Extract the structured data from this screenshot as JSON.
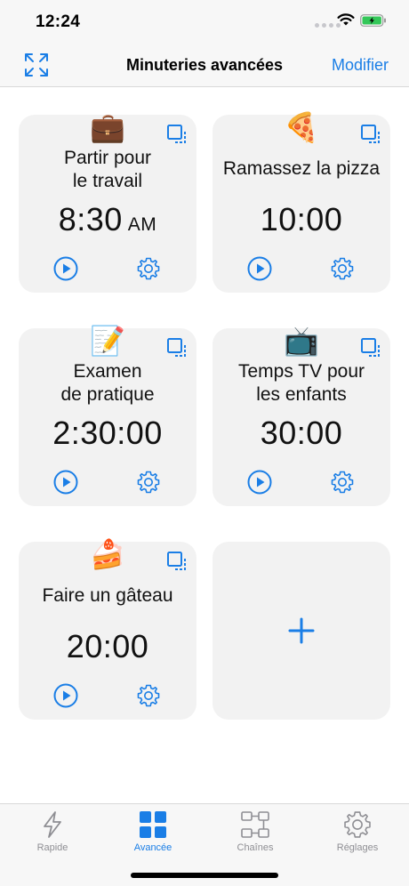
{
  "status": {
    "time": "12:24"
  },
  "nav": {
    "title": "Minuteries avancées",
    "edit_label": "Modifier"
  },
  "timers": [
    {
      "emoji": "💼",
      "title": "Partir pour\nle travail",
      "time": "8:30",
      "ampm": "AM"
    },
    {
      "emoji": "🍕",
      "title": "Ramassez la pizza",
      "time": "10:00"
    },
    {
      "emoji": "📝",
      "title": "Examen\nde pratique",
      "time": "2:30:00"
    },
    {
      "emoji": "📺",
      "title": "Temps TV pour\nles enfants",
      "time": "30:00"
    },
    {
      "emoji": "🍰",
      "title": "Faire un gâteau",
      "time": "20:00"
    }
  ],
  "tabs": [
    {
      "label": "Rapide",
      "icon": "bolt-icon",
      "active": false
    },
    {
      "label": "Avancée",
      "icon": "grid-icon",
      "active": true
    },
    {
      "label": "Chaînes",
      "icon": "chain-icon",
      "active": false
    },
    {
      "label": "Réglages",
      "icon": "gear-icon",
      "active": false
    }
  ],
  "colors": {
    "accent": "#1a7ee6",
    "card": "#f2f2f2",
    "inactive": "#8e8e93"
  }
}
